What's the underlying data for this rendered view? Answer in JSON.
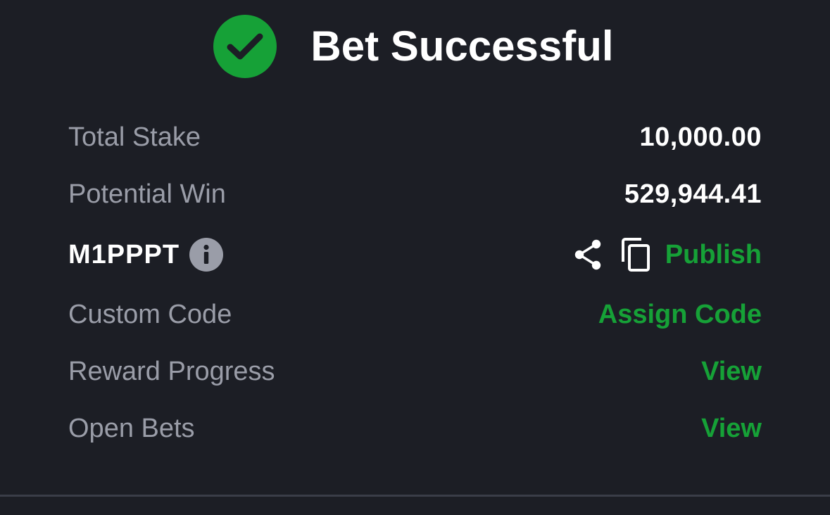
{
  "header": {
    "title": "Bet Successful",
    "icon": "check-circle-icon",
    "accent_color": "#16a137"
  },
  "details": {
    "total_stake": {
      "label": "Total Stake",
      "value": "10,000.00"
    },
    "potential_win": {
      "label": "Potential Win",
      "value": "529,944.41"
    },
    "booking_code": {
      "code": "M1PPPT",
      "info_icon": "info-icon",
      "share_icon": "share-icon",
      "copy_icon": "copy-icon",
      "publish_label": "Publish"
    },
    "custom_code": {
      "label": "Custom Code",
      "action": "Assign Code"
    },
    "reward_progress": {
      "label": "Reward Progress",
      "action": "View"
    },
    "open_bets": {
      "label": "Open Bets",
      "action": "View"
    }
  },
  "colors": {
    "background": "#1c1e25",
    "label_gray": "#9a9da8",
    "value_white": "#ffffff",
    "link_green": "#16a137"
  }
}
